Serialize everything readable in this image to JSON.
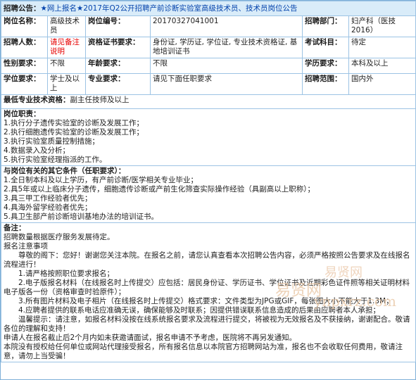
{
  "announcement": {
    "label": "招聘公告：",
    "title": "★网上报名★2017年Q2公开招聘产前诊断实验室高级技术员、技术员岗位公告"
  },
  "row1": {
    "pos_name_label": "岗位名称：",
    "pos_name_value": "高级技术员",
    "pos_code_label": "岗位编号：",
    "pos_code_value": "20170327041001",
    "dept_label": "招聘部门：",
    "dept_value": "妇产科（医技2016）"
  },
  "row2": {
    "count_label": "招聘人数：",
    "count_value": "请见备注说明",
    "cert_label": "资格证书要求：",
    "cert_value": "身份证, 学历证, 学位证, 专业技术资格证, 基地培训证书",
    "exam_label": "考试科目：",
    "exam_value": "待定"
  },
  "row3": {
    "gender_label": "性别要求：",
    "gender_value": "不限",
    "age_label": "年龄要求：",
    "age_value": "不限",
    "edu_label": "学历要求：",
    "edu_value": "本科及以上"
  },
  "row4": {
    "degree_label": "学位要求：",
    "degree_value": "学士及以上",
    "major_label": "专业要求：",
    "major_value": "请见下面任职要求",
    "scope_label": "招聘范围：",
    "scope_value": "国内外"
  },
  "row5": {
    "title_label": "最低专业技术资格：",
    "title_value": "副主任技师及以上"
  },
  "duties": {
    "title": "岗位职责：",
    "items": [
      "1.执行分子遗传实验室的诊断及发展工作；",
      "2.执行细胞遗传实验室的诊断及发展工作；",
      "3.执行实验室质量控制措施；",
      "4.数据录入及分析；",
      "5.执行实验室经理指派的工作。"
    ]
  },
  "requirements": {
    "title": "与岗位有关的其它条件（任职要求）：",
    "items": [
      "1.全日制本科及以上学历，有产前诊断/医学相关专业毕业；",
      "2.具5年或以上临床分子遗传，细胞遗传诊断或产前生化筛查实际操作经验（具副高以上职称）；",
      "3.具三甲工作经验者优先；",
      "4.具海外留学经验者优先；",
      "5.具卫生部产前诊断培训基地办法的培训证书。"
    ]
  },
  "notes": {
    "title": "备注：",
    "lines": [
      "招聘数量根据医疗服务发展待定。",
      "报名注意事项",
      "尊敬的阁下：您好！谢谢您关注本院。在报名之前，请您认真查看本次招聘公告内容，必须严格按照公告要求及在线报名流程进行！",
      "1.请严格按照职位要求报名；",
      "2.电子版报名材料（在线报名时上传提交）应包括：居民身份证、学历证书、学位证书及近期彩色证件照等相关证明材料电子版各一份（资格审查时验原件）；",
      "3.所有图片材料及电子相片（在线报名时上传提交）格式要求：文件类型为JPG或GIF，每张图大小不能大于1.3M；",
      "4.应聘者提供的联系电话应准确无误，确保能够及时联系；因提供错误联系信息造成的后果由应聘者本人承担；",
      "温馨提示：请注意，如报名材料没按在线系统报名要求及流程进行提交，将被视为无效报名及不获接纳，谢谢配合。敬请各位的理解和支持！",
      "申请人在报名截止后2个月内如未获邀请面试，报名申请不予考虑，医院将不再另发通知。",
      "本院没有授权给任何单位或网站代理接受报名，所有报名信息以本院官方招聘网站为准，报名也不会收取任何费用，敬请注意，请勿上当受骗！"
    ]
  },
  "watermark": {
    "text1": "易贤网",
    "text2": "ynpxrz.com",
    "text3": "易贤网"
  }
}
